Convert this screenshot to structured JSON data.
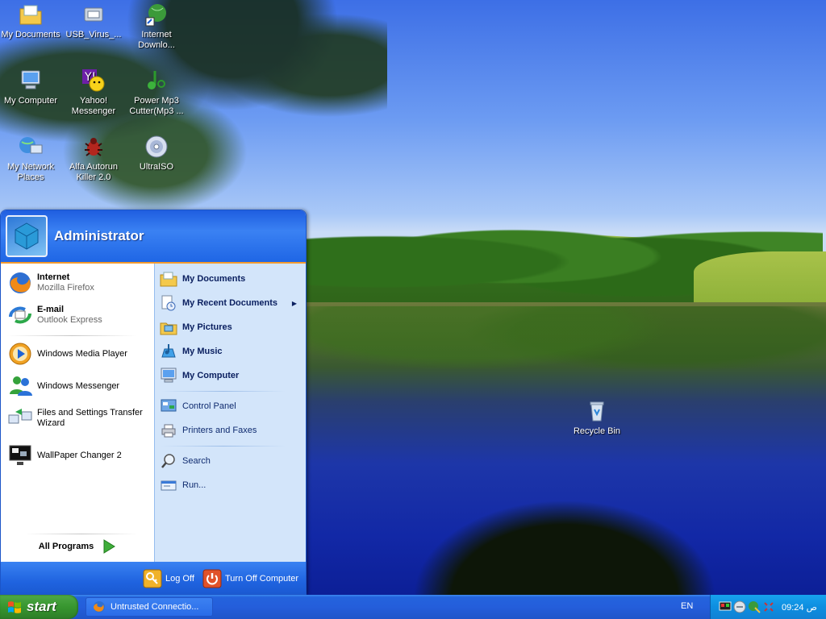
{
  "desktop_icons": [
    {
      "label": "My Documents",
      "icon": "folder-documents-icon"
    },
    {
      "label": "USB_Virus_...",
      "icon": "usb-virus-icon"
    },
    {
      "label": "Internet Downlo...",
      "icon": "internet-download-icon"
    },
    {
      "label": "My Computer",
      "icon": "computer-icon"
    },
    {
      "label": "Yahoo! Messenger",
      "icon": "yahoo-messenger-icon"
    },
    {
      "label": "Power Mp3 Cutter(Mp3 ...",
      "icon": "mp3-cutter-icon"
    },
    {
      "label": "My Network Places",
      "icon": "network-places-icon"
    },
    {
      "label": "Alfa Autorun Killer 2.0",
      "icon": "autorun-killer-icon"
    },
    {
      "label": "UltraISO",
      "icon": "ultraiso-icon"
    },
    {
      "label": "Recycle Bin",
      "icon": "recycle-bin-icon"
    }
  ],
  "start_menu": {
    "user": "Administrator",
    "pinned": [
      {
        "title": "Internet",
        "subtitle": "Mozilla Firefox",
        "icon": "firefox-icon"
      },
      {
        "title": "E-mail",
        "subtitle": "Outlook Express",
        "icon": "outlook-express-icon"
      }
    ],
    "recent": [
      {
        "label": "Windows Media Player",
        "icon": "media-player-icon"
      },
      {
        "label": "Windows Messenger",
        "icon": "windows-messenger-icon"
      },
      {
        "label": "Files and Settings Transfer Wizard",
        "icon": "transfer-wizard-icon"
      },
      {
        "label": "WallPaper Changer 2",
        "icon": "wallpaper-changer-icon"
      }
    ],
    "all_programs": "All Programs",
    "right_items": [
      {
        "label": "My Documents",
        "icon": "folder-documents-icon"
      },
      {
        "label": "My Recent Documents",
        "icon": "recent-documents-icon"
      },
      {
        "label": "My Pictures",
        "icon": "pictures-folder-icon"
      },
      {
        "label": "My Music",
        "icon": "music-folder-icon"
      },
      {
        "label": "My Computer",
        "icon": "computer-icon"
      },
      {
        "label": "Control Panel",
        "icon": "control-panel-icon"
      },
      {
        "label": "Printers and Faxes",
        "icon": "printer-icon"
      },
      {
        "label": "Search",
        "icon": "search-icon"
      },
      {
        "label": "Run...",
        "icon": "run-icon"
      }
    ],
    "log_off": "Log Off",
    "turn_off": "Turn Off Computer"
  },
  "taskbar": {
    "start_label": "start",
    "task_label": "Untrusted Connectio...",
    "language": "EN",
    "clock": "09:24 ص"
  },
  "colors": {
    "taskbar_blue": "#245edb",
    "start_green": "#37962f",
    "tray_blue": "#0e8ee0",
    "menu_orange_line": "#f29a2e"
  }
}
